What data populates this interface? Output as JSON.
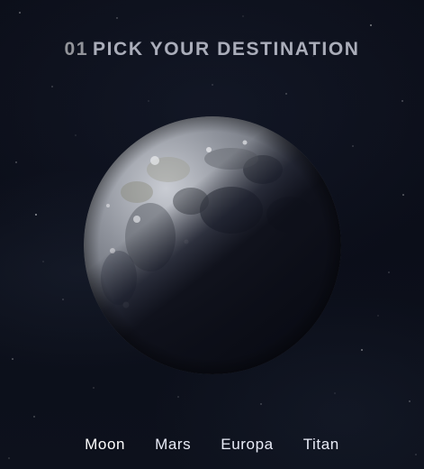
{
  "step": {
    "number": "01",
    "title": "PICK YOUR DESTINATION"
  },
  "destination_image": {
    "subject": "Moon"
  },
  "tabs": [
    {
      "label": "Moon"
    },
    {
      "label": "Mars"
    },
    {
      "label": "Europa"
    },
    {
      "label": "Titan"
    }
  ],
  "colors": {
    "background": "#0b0d17",
    "heading_accent": "#d0d6f9",
    "text": "#ffffff"
  }
}
